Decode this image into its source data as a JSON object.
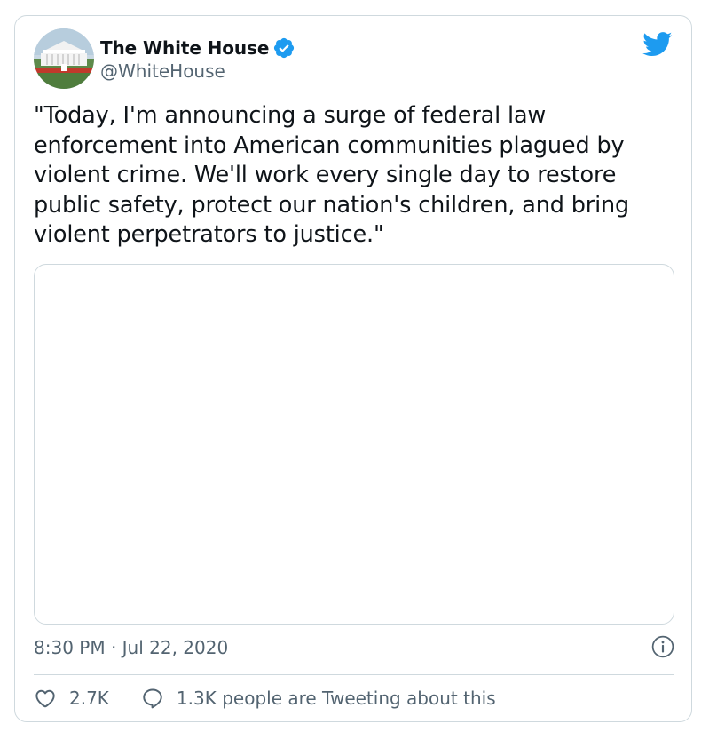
{
  "author": {
    "display_name": "The White House",
    "handle": "@WhiteHouse",
    "avatar_icon": "white-house-building-avatar",
    "verified": true
  },
  "tweet": {
    "text": "\"Today, I'm announcing a surge of federal law\nenforcement into American communities plagued by\nviolent crime. We'll work every single day to restore\npublic safety, protect our nation's children, and bring\nviolent perpetrators to justice.\"",
    "timestamp": "8:30 PM · Jul 22, 2020"
  },
  "engagement": {
    "likes": "2.7K",
    "conversation": "1.3K people are Tweeting about this"
  },
  "colors": {
    "brand_blue": "#1d9bf0",
    "text_primary": "#0f1419",
    "text_secondary": "#536471",
    "border": "#cfd9de"
  },
  "icons": {
    "brand": "twitter-bird-icon",
    "verified": "verified-badge-icon",
    "info": "info-icon",
    "like": "heart-icon",
    "reply": "speech-bubble-icon"
  }
}
